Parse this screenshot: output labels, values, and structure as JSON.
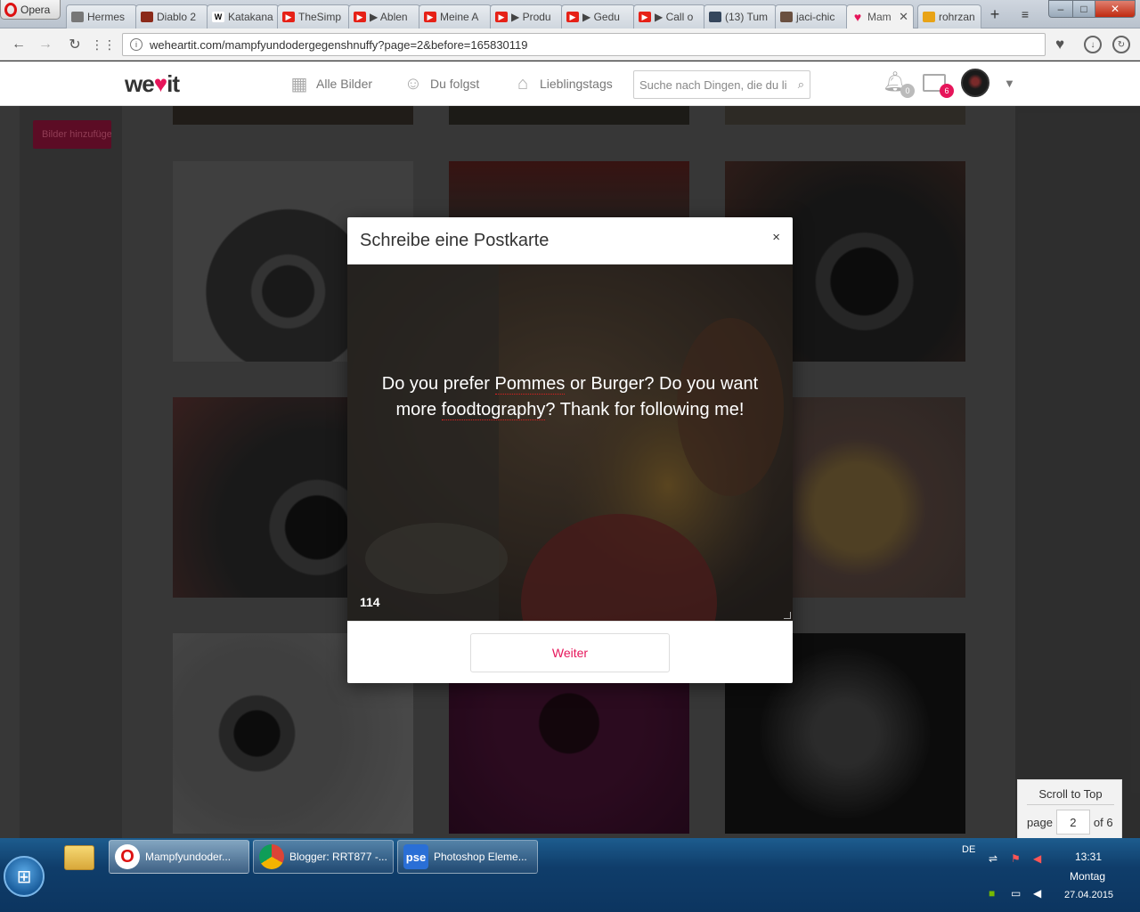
{
  "browser": {
    "menu_label": "Opera",
    "tabs": [
      {
        "title": "Hermes",
        "icon": "document-icon",
        "color": "#777777"
      },
      {
        "title": "Diablo 2",
        "icon": "diablo-icon",
        "color": "#8b2a1a"
      },
      {
        "title": "Katakana",
        "icon": "wikipedia-icon",
        "color": "#ffffff"
      },
      {
        "title": "TheSimp",
        "icon": "youtube-icon",
        "color": "#e62117"
      },
      {
        "title": "▶ Ablen",
        "icon": "youtube-icon",
        "color": "#e62117"
      },
      {
        "title": "Meine A",
        "icon": "youtube-icon",
        "color": "#e62117"
      },
      {
        "title": "▶ Produ",
        "icon": "youtube-icon",
        "color": "#e62117"
      },
      {
        "title": "▶ Gedu",
        "icon": "youtube-icon",
        "color": "#e62117"
      },
      {
        "title": "▶ Call o",
        "icon": "youtube-icon",
        "color": "#e62117"
      },
      {
        "title": "(13) Tum",
        "icon": "tumblr-icon",
        "color": "#35465c"
      },
      {
        "title": "jaci-chic",
        "icon": "tumblr-avatar-icon",
        "color": "#6a5040"
      },
      {
        "title": "Mam",
        "icon": "weheartit-icon",
        "color": "#e6155a",
        "active": true
      },
      {
        "title": "rohrzan",
        "icon": "blogger-icon",
        "color": "#e8a317"
      }
    ],
    "url": "weheartit.com/mampfyundodergegenshnuffy?page=2&before=165830119"
  },
  "site": {
    "logo": {
      "we": "we",
      "it": "it"
    },
    "nav": [
      {
        "label": "Alle Bilder",
        "icon": "grid-icon"
      },
      {
        "label": "Du folgst",
        "icon": "user-follow-icon"
      },
      {
        "label": "Lieblingstags",
        "icon": "tag-icon"
      }
    ],
    "search_placeholder": "Suche nach Dingen, die du li",
    "notifications_count": "0",
    "messages_count": "6",
    "add_images_label": "Bilder hinzufügen",
    "accent": "#e6155a"
  },
  "modal": {
    "title": "Schreibe eine Postkarte",
    "close": "×",
    "text_before": "Do you prefer ",
    "text_word1": "Pommes",
    "text_mid": " or Burger? Do you want more ",
    "text_word2": "foodtography",
    "text_after": "? Thank for following me!",
    "char_count": "114",
    "submit_label": "Weiter"
  },
  "pagination": {
    "scroll_top": "Scroll to Top",
    "page_label": "page",
    "page_value": "2",
    "of_label": "of 6"
  },
  "taskbar": {
    "items": [
      {
        "label": "Mampfyundoder...",
        "icon": "opera-icon",
        "active": true
      },
      {
        "label": "Blogger: RRT877 -...",
        "icon": "chrome-icon"
      },
      {
        "label": "Photoshop Eleme...",
        "icon": "photoshop-elements-icon",
        "icon_text": "pse"
      }
    ],
    "language": "DE",
    "time": "13:31",
    "day": "Montag",
    "date": "27.04.2015"
  }
}
